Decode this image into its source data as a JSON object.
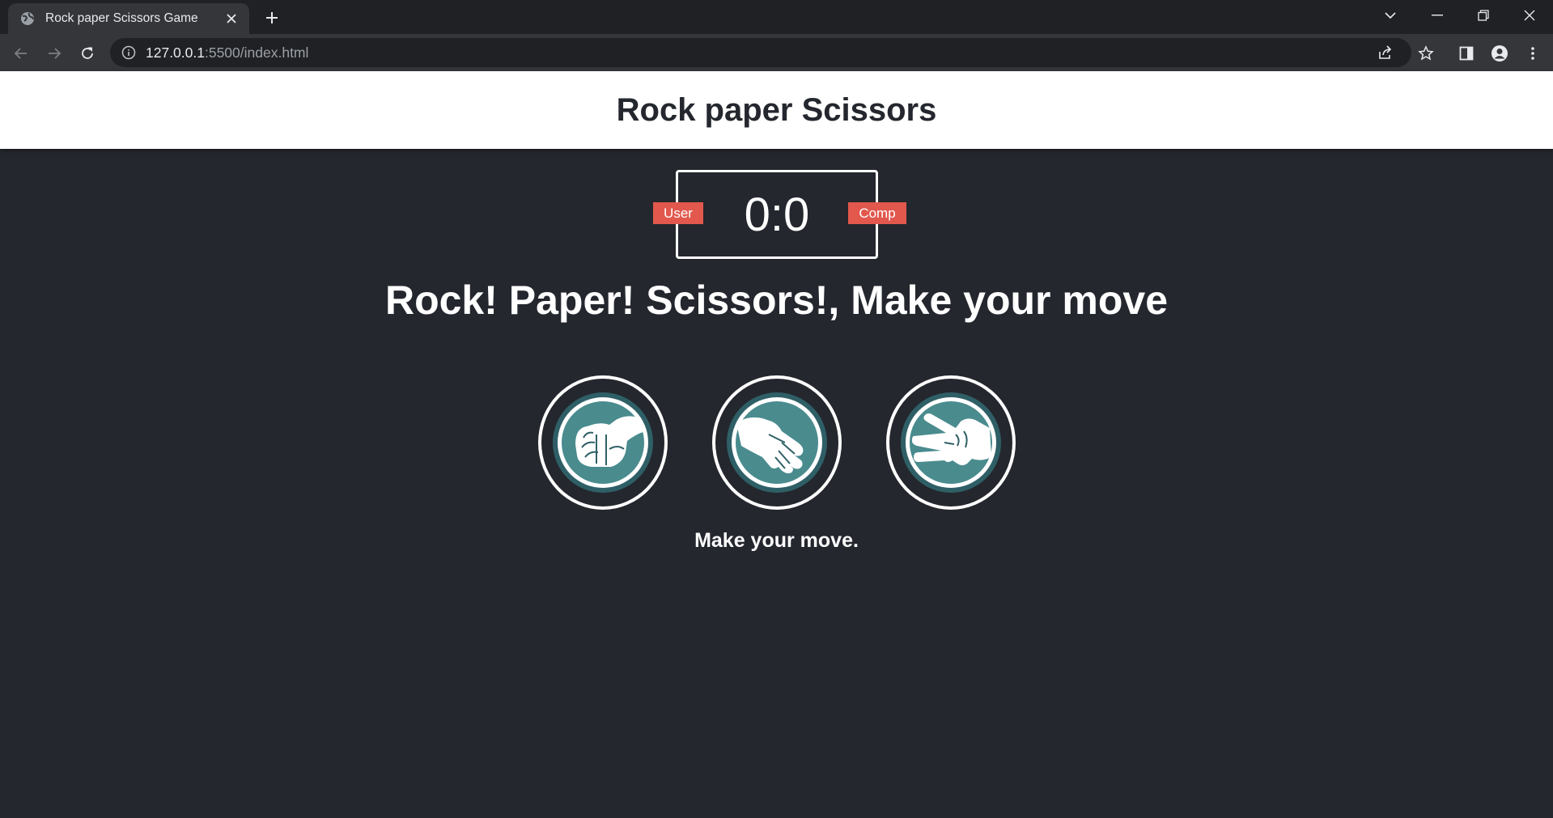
{
  "browser": {
    "tab_title": "Rock paper Scissors Game",
    "url_host": "127.0.0.1",
    "url_rest": ":5500/index.html"
  },
  "header": {
    "title": "Rock paper Scissors"
  },
  "scoreboard": {
    "user_label": "User",
    "comp_label": "Comp",
    "score": "0:0"
  },
  "result": {
    "message": "Rock! Paper! Scissors!, Make your move"
  },
  "choices": [
    {
      "name": "rock",
      "icon": "rock-hand-icon"
    },
    {
      "name": "paper",
      "icon": "paper-hand-icon"
    },
    {
      "name": "scissors",
      "icon": "scissors-hand-icon"
    }
  ],
  "action": {
    "message": "Make your move."
  },
  "colors": {
    "page_bg": "#24272e",
    "badge": "#e2584d",
    "choice_outer": "#2f5f66",
    "choice_inner": "#4a8b8e",
    "white": "#ffffff"
  }
}
